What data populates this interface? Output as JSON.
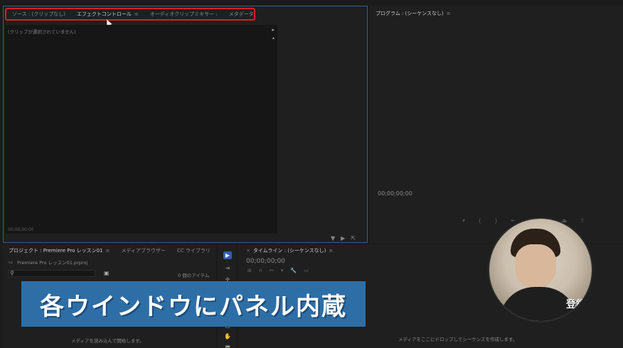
{
  "source_panel": {
    "tabs": [
      {
        "label": "ソース : (クリップなし)",
        "active": false
      },
      {
        "label": "エフェクトコントロール",
        "active": true
      },
      {
        "label": "オーディオクリップミキサー :",
        "active": false
      },
      {
        "label": "メタデータ",
        "active": false
      }
    ],
    "menu_glyph": "≡",
    "empty_message": "(クリップが選択されていません)",
    "timecode": "00;00;00;00",
    "highlight_color": "#d62020"
  },
  "program_panel": {
    "tab_label": "プログラム : (シーケンスなし)",
    "menu_glyph": "≡",
    "timecode": "00;00;00;00"
  },
  "project_panel": {
    "tabs": [
      {
        "label": "プロジェクト : Premiere Pro レッスン01",
        "active": true
      },
      {
        "label": "メディアブラウザー",
        "active": false
      },
      {
        "label": "CC ライブラリ",
        "active": false
      }
    ],
    "menu_glyph": "≡",
    "overflow_glyph": "»",
    "file_name": "Premiere Pro レッスン01.prproj",
    "item_count": "0 個のアイテム",
    "empty_hint": "メディアを読み込んで開始します。"
  },
  "timeline_panel": {
    "tab_label": "タイムライン : (シーケンスなし)",
    "menu_glyph": "≡",
    "timecode": "00;00;00;00",
    "empty_hint": "メディアをここにドロップしてシーケンスを作成します。"
  },
  "caption": {
    "text": "各ウインドウにパネル内蔵",
    "background": "#2e6ea6"
  },
  "presenter": {
    "subscribe_label": "登録"
  }
}
